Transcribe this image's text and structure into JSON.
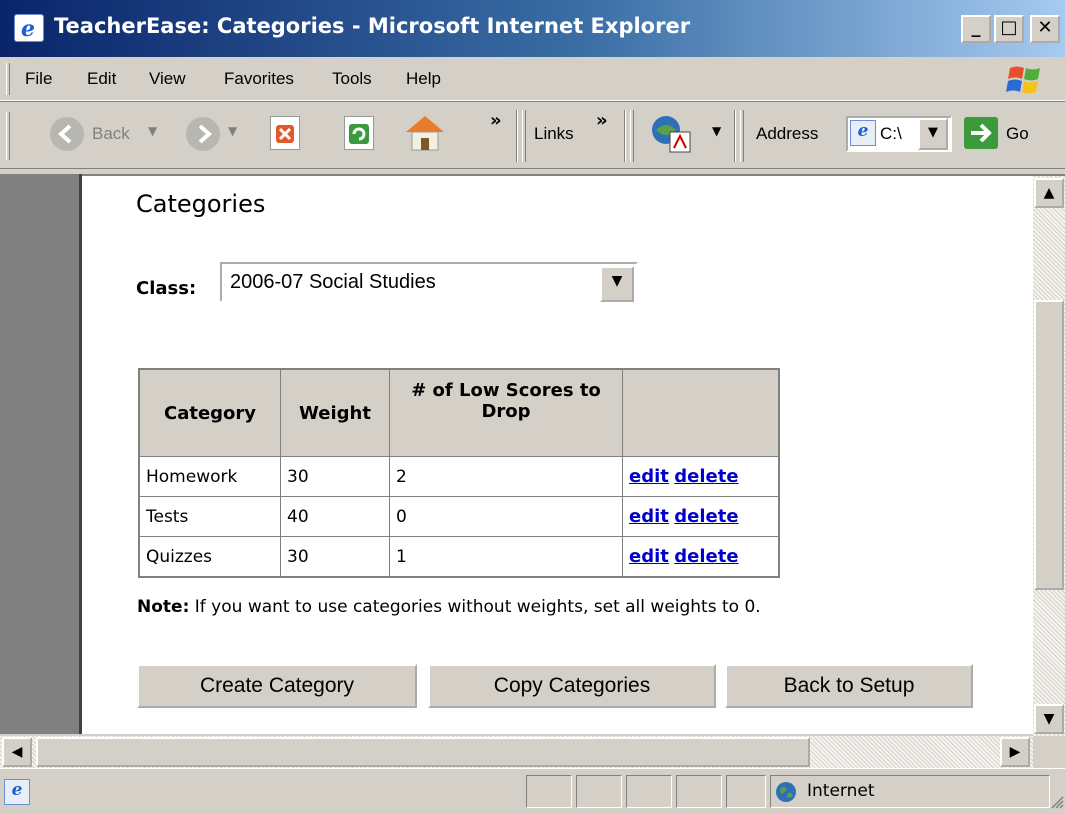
{
  "window": {
    "title": "TeacherEase: Categories - Microsoft Internet Explorer",
    "minimize": "_",
    "maximize": "□",
    "close": "✕"
  },
  "menu": [
    "File",
    "Edit",
    "View",
    "Favorites",
    "Tools",
    "Help"
  ],
  "toolbar": {
    "back_label": "Back",
    "chevron": "»",
    "links_label": "Links",
    "address_label": "Address",
    "address_value": "C:\\",
    "go_label": "Go"
  },
  "page": {
    "title": "Categories",
    "class_label": "Class:",
    "class_value": "2006-07 Social Studies",
    "table": {
      "headers": [
        "Category",
        "Weight",
        "# of Low Scores to Drop",
        ""
      ],
      "rows": [
        {
          "category": "Homework",
          "weight": "30",
          "drop": "2",
          "edit": "edit",
          "delete": "delete"
        },
        {
          "category": "Tests",
          "weight": "40",
          "drop": "0",
          "edit": "edit",
          "delete": "delete"
        },
        {
          "category": "Quizzes",
          "weight": "30",
          "drop": "1",
          "edit": "edit",
          "delete": "delete"
        }
      ]
    },
    "note_bold": "Note:",
    "note_text": " If you want to use categories without weights, set all weights to 0.",
    "buttons": {
      "create": "Create Category",
      "copy": "Copy Categories",
      "back": "Back to Setup"
    }
  },
  "status": {
    "zone": "Internet"
  }
}
